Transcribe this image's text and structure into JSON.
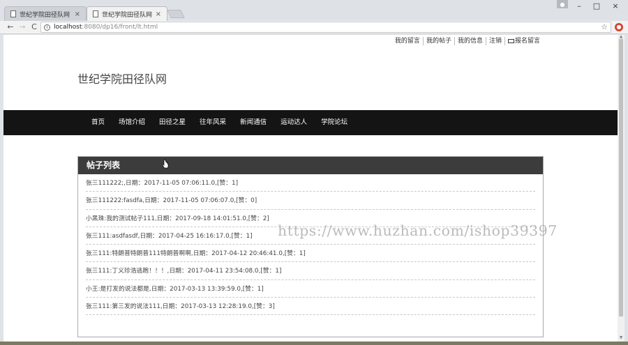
{
  "browser": {
    "tabs": [
      {
        "title": "世纪学院田径队网",
        "close": "×"
      },
      {
        "title": "世纪学院田径队网",
        "close": "×"
      }
    ],
    "url_host": "localhost",
    "url_path": ":8080/dp16/front/lt.html",
    "window_controls": {
      "minimize": "–",
      "maximize": "□",
      "close": "×"
    },
    "nav": {
      "back": "←",
      "forward": "→",
      "reload": "C"
    }
  },
  "topbar": {
    "links": [
      "我的留言",
      "我的帖子",
      "我的信息",
      "注销",
      "报名留言"
    ]
  },
  "site": {
    "title": "世纪学院田径队网"
  },
  "mainnav": {
    "items": [
      "首页",
      "场馆介绍",
      "田径之星",
      "往年风采",
      "新闻通信",
      "运动达人",
      "学院论坛"
    ]
  },
  "panel": {
    "title": "帖子列表",
    "posts": [
      "张三111222;,日期：2017-11-05 07:06:11.0,[赞：1]",
      "张三111222:fasdfa,日期：2017-11-05 07:06:07.0,[赞：0]",
      "小黑珠:我的测试帖子111,日期：2017-09-18 14:01:51.0,[赞：2]",
      "张三111:asdfasdf,日期：2017-04-25 16:16:17.0,[赞：1]",
      "张三111:特朗普特朗普111特朗普啊啊,日期：2017-04-12 20:46:41.0,[赞：1]",
      "张三111:丁义珍浩逃跑！！！,日期：2017-04-11 23:54:08.0,[赞：1]",
      "小王:是打发的说法都是,日期：2017-03-13 13:39:59.0,[赞：1]",
      "张三111:第三发的说法111,日期：2017-03-13 12:28:19.0,[赞：3]"
    ]
  },
  "watermark": "https://www.huzhan.com/ishop39397"
}
